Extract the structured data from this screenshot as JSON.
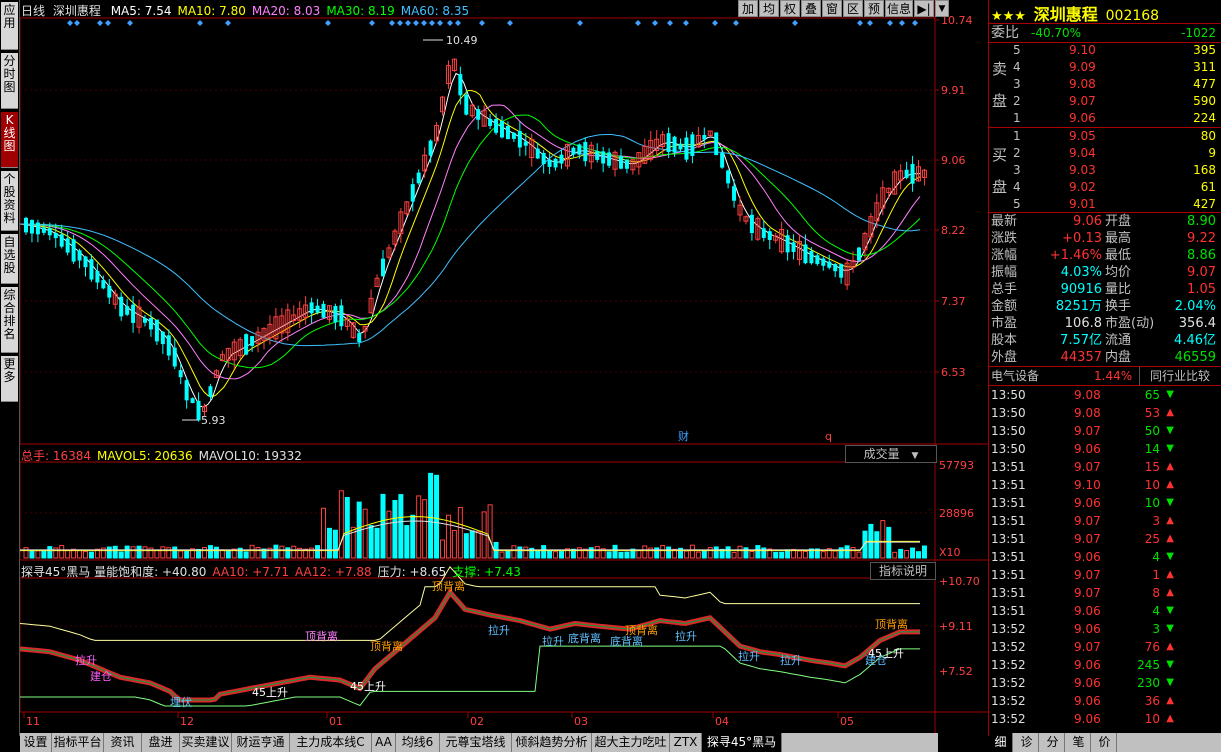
{
  "left_tabs": [
    "应用",
    "分时图",
    "K线图",
    "个股资料",
    "自选股",
    "综合排名",
    "更多"
  ],
  "left_tab_active": 2,
  "toolbar": [
    "加",
    "均",
    "权",
    "叠",
    "窗",
    "区",
    "预",
    "信息"
  ],
  "price_header": {
    "period": "日线",
    "name": "深圳惠程",
    "items": [
      {
        "text": "MA5: 7.54",
        "color": "#ffffff"
      },
      {
        "text": "MA10: 7.80",
        "color": "#ffff00"
      },
      {
        "text": "MA20: 8.03",
        "color": "#ff80ff"
      },
      {
        "text": "MA30: 8.19",
        "color": "#00ff00"
      },
      {
        "text": "MA60: 8.35",
        "color": "#40c0ff"
      }
    ]
  },
  "price_axis": [
    "10.74",
    "9.91",
    "9.06",
    "8.22",
    "7.37",
    "6.53"
  ],
  "annotations": {
    "high": "10.49",
    "low": "5.93",
    "cai": "财",
    "q": "q"
  },
  "vol_header": {
    "items": [
      {
        "text": "总手: 16384",
        "color": "#ff4040"
      },
      {
        "text": "MAVOL5: 20636",
        "color": "#ffff00"
      },
      {
        "text": "MAVOL10: 19332",
        "color": "#e0e0e0"
      }
    ],
    "dropdown": "成交量"
  },
  "vol_axis": [
    "57793",
    "28896",
    "X10"
  ],
  "ind_header": {
    "items": [
      {
        "text": "探寻45°黑马 量能饱和度: +40.80",
        "color": "#e0e0e0"
      },
      {
        "text": "AA10: +7.71",
        "color": "#ff4040"
      },
      {
        "text": "AA12: +7.88",
        "color": "#ff4040"
      },
      {
        "text": "压力: +8.65",
        "color": "#e0e0e0"
      },
      {
        "text": "支撑: +7.43",
        "color": "#00ff00"
      }
    ],
    "button": "指标说明"
  },
  "ind_axis": [
    "+10.70",
    "+9.11",
    "+7.52"
  ],
  "ind_labels": [
    "拉升",
    "建仓",
    "埋伏",
    "顶背离",
    "顶背离",
    "45上升",
    "45上升",
    "拉升",
    "顶背离",
    "拉升",
    "底背离",
    "顶背离",
    "拉升",
    "拉升",
    "拉升",
    "底背离",
    "顶背离",
    "45上升",
    "建仓"
  ],
  "x_axis": [
    "11",
    "12",
    "01",
    "02",
    "03",
    "04",
    "05"
  ],
  "bottom_tabs": [
    "设置",
    "指标平台",
    "资讯",
    "盘进",
    "买卖建议",
    "财运亨通",
    "主力成本线C",
    "AA",
    "均线6",
    "元尊宝塔线",
    "倾斜趋势分析",
    "超大主力吃吐",
    "ZTX",
    "探寻45°黑马"
  ],
  "bottom_active": 13,
  "quote": {
    "stars": "★★★",
    "name": "深圳惠程",
    "code": "002168",
    "weibi_label": "委比",
    "weibi": "-40.70%",
    "weicha": "-1022",
    "sell_label": [
      "卖",
      "盘"
    ],
    "buy_label": [
      "买",
      "盘"
    ],
    "sell": [
      {
        "lvl": "5",
        "price": "9.10",
        "vol": "395"
      },
      {
        "lvl": "4",
        "price": "9.09",
        "vol": "311"
      },
      {
        "lvl": "3",
        "price": "9.08",
        "vol": "477"
      },
      {
        "lvl": "2",
        "price": "9.07",
        "vol": "590"
      },
      {
        "lvl": "1",
        "price": "9.06",
        "vol": "224"
      }
    ],
    "buy": [
      {
        "lvl": "1",
        "price": "9.05",
        "vol": "80"
      },
      {
        "lvl": "2",
        "price": "9.04",
        "vol": "9"
      },
      {
        "lvl": "3",
        "price": "9.03",
        "vol": "168"
      },
      {
        "lvl": "4",
        "price": "9.02",
        "vol": "61"
      },
      {
        "lvl": "5",
        "price": "9.01",
        "vol": "427"
      }
    ],
    "stats": [
      {
        "l1": "最新",
        "v1": "9.06",
        "c1": "red",
        "l2": "开盘",
        "v2": "8.90",
        "c2": "green"
      },
      {
        "l1": "涨跌",
        "v1": "+0.13",
        "c1": "red",
        "l2": "最高",
        "v2": "9.22",
        "c2": "red"
      },
      {
        "l1": "涨幅",
        "v1": "+1.46%",
        "c1": "red",
        "l2": "最低",
        "v2": "8.86",
        "c2": "green"
      },
      {
        "l1": "振幅",
        "v1": "4.03%",
        "c1": "cyan",
        "l2": "均价",
        "v2": "9.07",
        "c2": "red"
      },
      {
        "l1": "总手",
        "v1": "90916",
        "c1": "cyan",
        "l2": "量比",
        "v2": "1.05",
        "c2": "red"
      },
      {
        "l1": "金额",
        "v1": "8251万",
        "c1": "cyan",
        "l2": "换手",
        "v2": "2.04%",
        "c2": "cyan"
      },
      {
        "l1": "市盈",
        "v1": "106.8",
        "c1": "white",
        "l2": "市盈(动)",
        "v2": "356.4",
        "c2": "white"
      },
      {
        "l1": "股本",
        "v1": "7.57亿",
        "c1": "cyan",
        "l2": "流通",
        "v2": "4.46亿",
        "c2": "cyan"
      },
      {
        "l1": "外盘",
        "v1": "44357",
        "c1": "red",
        "l2": "内盘",
        "v2": "46559",
        "c2": "green"
      }
    ],
    "sector": "电气设备",
    "sector_pct": "1.44%",
    "compare_btn": "同行业比较",
    "ticks": [
      {
        "t": "13:50",
        "p": "9.08",
        "v": "65",
        "d": "down"
      },
      {
        "t": "13:50",
        "p": "9.08",
        "v": "53",
        "d": "up"
      },
      {
        "t": "13:50",
        "p": "9.07",
        "v": "50",
        "d": "down"
      },
      {
        "t": "13:50",
        "p": "9.06",
        "v": "14",
        "d": "down"
      },
      {
        "t": "13:51",
        "p": "9.07",
        "v": "15",
        "d": "up"
      },
      {
        "t": "13:51",
        "p": "9.10",
        "v": "10",
        "d": "up"
      },
      {
        "t": "13:51",
        "p": "9.06",
        "v": "10",
        "d": "down"
      },
      {
        "t": "13:51",
        "p": "9.07",
        "v": "3",
        "d": "up"
      },
      {
        "t": "13:51",
        "p": "9.07",
        "v": "25",
        "d": "up"
      },
      {
        "t": "13:51",
        "p": "9.06",
        "v": "4",
        "d": "down"
      },
      {
        "t": "13:51",
        "p": "9.07",
        "v": "1",
        "d": "up"
      },
      {
        "t": "13:51",
        "p": "9.07",
        "v": "8",
        "d": "up"
      },
      {
        "t": "13:51",
        "p": "9.06",
        "v": "4",
        "d": "down"
      },
      {
        "t": "13:52",
        "p": "9.06",
        "v": "3",
        "d": "down"
      },
      {
        "t": "13:52",
        "p": "9.07",
        "v": "76",
        "d": "up"
      },
      {
        "t": "13:52",
        "p": "9.06",
        "v": "245",
        "d": "down"
      },
      {
        "t": "13:52",
        "p": "9.06",
        "v": "230",
        "d": "down"
      },
      {
        "t": "13:52",
        "p": "9.06",
        "v": "36",
        "d": "up"
      },
      {
        "t": "13:52",
        "p": "9.06",
        "v": "10",
        "d": "up"
      }
    ],
    "bottom_tabs": [
      "细",
      "诊",
      "分",
      "笔",
      "价"
    ]
  }
}
